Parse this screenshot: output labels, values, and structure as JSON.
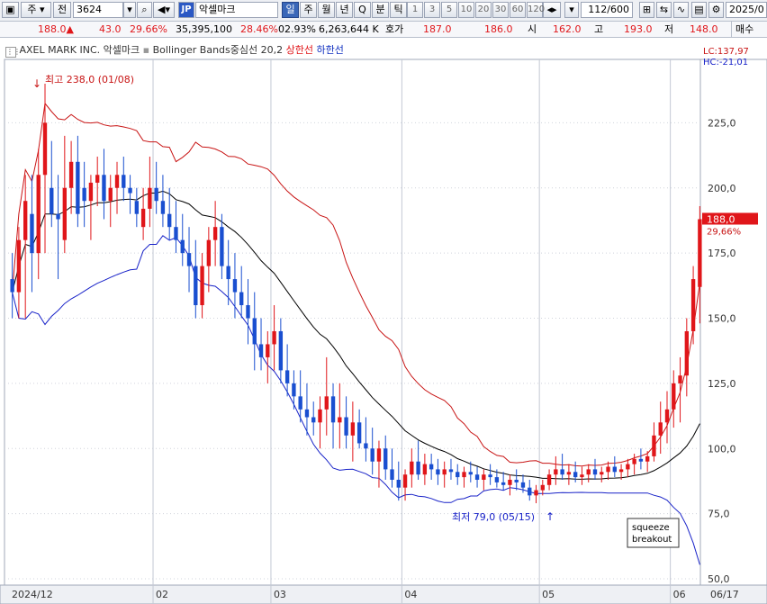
{
  "toolbar": {
    "market_type": "주",
    "view_type": "전",
    "code": "3624",
    "country_badge": "JP",
    "name": "악셀마크",
    "periods": [
      "일",
      "주",
      "월",
      "년",
      "Q",
      "분",
      "틱"
    ],
    "intervals": [
      "1",
      "3",
      "5",
      "10",
      "20",
      "30",
      "60",
      "120"
    ],
    "count": "112/600",
    "date": "2025/0",
    "icons": [
      "layout-icon",
      "search-icon",
      "sound-icon",
      "dropdown-icon",
      "chart-tool-icon",
      "compare-icon",
      "save-icon",
      "gear-icon"
    ]
  },
  "quote": {
    "price": "188.0",
    "change": "43.0",
    "change_pct": "29.66%",
    "volume": "35,395,100",
    "volume_pct": "28.46%",
    "turnover_pct": "02.93%",
    "amount": "6,263,644 K",
    "ask_label": "호가",
    "ask": "187.0",
    "bid": "186.0",
    "open_label": "시",
    "open": "162.0",
    "high_label": "고",
    "high": "193.0",
    "low_label": "저",
    "low": "148.0",
    "order_label": "매수"
  },
  "legend": {
    "company": "AXEL MARK INC.",
    "name_kr": "악셀마크",
    "indicator": "Bollinger Bands중심선 20,2",
    "upper": "상한선",
    "lower": "하한선"
  },
  "colors": {
    "up": "#e0161a",
    "down": "#1a4fd0",
    "upper_band": "#c81414",
    "lower_band": "#1822c8",
    "mid_band": "#000000"
  },
  "chart_data": {
    "type": "candlestick",
    "ylim": [
      50,
      250
    ],
    "y_ticks": [
      50,
      75,
      100,
      125,
      150,
      175,
      200,
      225
    ],
    "y_tick_labels": [
      "50,0",
      "75,0",
      "100,0",
      "125,0",
      "150,0",
      "175,0",
      "200,0",
      "225,0"
    ],
    "x_labels": [
      "2024/12",
      "02",
      "03",
      "04",
      "05",
      "06",
      "06/17"
    ],
    "x_label_index": [
      0,
      22,
      40,
      60,
      81,
      101,
      111
    ],
    "candles": [
      [
        165,
        175,
        150,
        160
      ],
      [
        160,
        185,
        150,
        180
      ],
      [
        180,
        205,
        150,
        195
      ],
      [
        190,
        205,
        160,
        175
      ],
      [
        175,
        215,
        165,
        205
      ],
      [
        205,
        240,
        175,
        225
      ],
      [
        200,
        218,
        185,
        190
      ],
      [
        190,
        205,
        165,
        188
      ],
      [
        180,
        220,
        175,
        200
      ],
      [
        200,
        218,
        190,
        210
      ],
      [
        210,
        220,
        185,
        190
      ],
      [
        200,
        210,
        185,
        195
      ],
      [
        195,
        205,
        180,
        202
      ],
      [
        202,
        212,
        193,
        205
      ],
      [
        205,
        215,
        188,
        195
      ],
      [
        195,
        205,
        185,
        200
      ],
      [
        200,
        210,
        190,
        205
      ],
      [
        205,
        212,
        195,
        200
      ],
      [
        200,
        205,
        190,
        198
      ],
      [
        195,
        200,
        185,
        190
      ],
      [
        185,
        200,
        180,
        192
      ],
      [
        192,
        212,
        185,
        200
      ],
      [
        200,
        210,
        190,
        195
      ],
      [
        195,
        205,
        185,
        190
      ],
      [
        190,
        200,
        180,
        185
      ],
      [
        185,
        195,
        175,
        180
      ],
      [
        180,
        190,
        170,
        175
      ],
      [
        175,
        185,
        160,
        170
      ],
      [
        170,
        180,
        150,
        155
      ],
      [
        155,
        175,
        150,
        170
      ],
      [
        170,
        185,
        160,
        180
      ],
      [
        180,
        195,
        170,
        185
      ],
      [
        185,
        190,
        165,
        170
      ],
      [
        170,
        180,
        155,
        165
      ],
      [
        165,
        175,
        150,
        160
      ],
      [
        160,
        170,
        150,
        155
      ],
      [
        155,
        165,
        140,
        150
      ],
      [
        150,
        160,
        130,
        140
      ],
      [
        140,
        150,
        130,
        135
      ],
      [
        135,
        145,
        125,
        140
      ],
      [
        140,
        155,
        130,
        145
      ],
      [
        145,
        150,
        125,
        130
      ],
      [
        130,
        140,
        120,
        125
      ],
      [
        125,
        130,
        115,
        120
      ],
      [
        120,
        130,
        110,
        115
      ],
      [
        115,
        125,
        105,
        112
      ],
      [
        112,
        118,
        105,
        110
      ],
      [
        110,
        120,
        100,
        115
      ],
      [
        115,
        135,
        105,
        120
      ],
      [
        120,
        125,
        100,
        110
      ],
      [
        110,
        125,
        100,
        112
      ],
      [
        112,
        120,
        100,
        105
      ],
      [
        105,
        118,
        95,
        110
      ],
      [
        110,
        115,
        100,
        102
      ],
      [
        102,
        112,
        95,
        100
      ],
      [
        100,
        108,
        90,
        95
      ],
      [
        95,
        103,
        85,
        100
      ],
      [
        100,
        105,
        88,
        92
      ],
      [
        92,
        100,
        85,
        88
      ],
      [
        88,
        95,
        80,
        85
      ],
      [
        85,
        92,
        80,
        90
      ],
      [
        90,
        100,
        85,
        95
      ],
      [
        95,
        103,
        88,
        90
      ],
      [
        90,
        98,
        86,
        94
      ],
      [
        94,
        98,
        88,
        92
      ],
      [
        92,
        96,
        86,
        90
      ],
      [
        90,
        95,
        85,
        92
      ],
      [
        92,
        96,
        88,
        91
      ],
      [
        91,
        94,
        86,
        89
      ],
      [
        89,
        93,
        85,
        91
      ],
      [
        91,
        95,
        87,
        90
      ],
      [
        90,
        93,
        85,
        88
      ],
      [
        88,
        92,
        84,
        90
      ],
      [
        90,
        94,
        86,
        89
      ],
      [
        89,
        92,
        85,
        87
      ],
      [
        87,
        91,
        84,
        86
      ],
      [
        86,
        90,
        82,
        88
      ],
      [
        88,
        92,
        84,
        87
      ],
      [
        87,
        90,
        83,
        85
      ],
      [
        85,
        88,
        80,
        82
      ],
      [
        82,
        86,
        79,
        84
      ],
      [
        84,
        88,
        82,
        86
      ],
      [
        86,
        92,
        84,
        90
      ],
      [
        90,
        97,
        86,
        92
      ],
      [
        92,
        98,
        88,
        90
      ],
      [
        90,
        94,
        86,
        91
      ],
      [
        91,
        95,
        87,
        89
      ],
      [
        89,
        93,
        86,
        90
      ],
      [
        90,
        94,
        87,
        92
      ],
      [
        92,
        96,
        88,
        90
      ],
      [
        90,
        93,
        87,
        91
      ],
      [
        91,
        95,
        88,
        93
      ],
      [
        93,
        97,
        89,
        91
      ],
      [
        91,
        94,
        88,
        92
      ],
      [
        92,
        96,
        89,
        94
      ],
      [
        94,
        98,
        90,
        96
      ],
      [
        96,
        100,
        92,
        95
      ],
      [
        95,
        99,
        91,
        97
      ],
      [
        97,
        110,
        95,
        105
      ],
      [
        105,
        118,
        98,
        110
      ],
      [
        110,
        122,
        102,
        115
      ],
      [
        115,
        130,
        108,
        125
      ],
      [
        125,
        135,
        110,
        128
      ],
      [
        128,
        150,
        120,
        145
      ],
      [
        145,
        170,
        140,
        165
      ],
      [
        162,
        193,
        148,
        188
      ]
    ],
    "annotations": {
      "high_label": "최고 238,0 (01/08)",
      "low_label": "최저 79,0 (05/15)",
      "squeeze_label": [
        "squeeze",
        "breakout"
      ],
      "lc_label": "LC:137,97",
      "hc_label": "HC:-21,01",
      "last_price_label": "188,0",
      "last_pct_label": "29,66%"
    }
  }
}
